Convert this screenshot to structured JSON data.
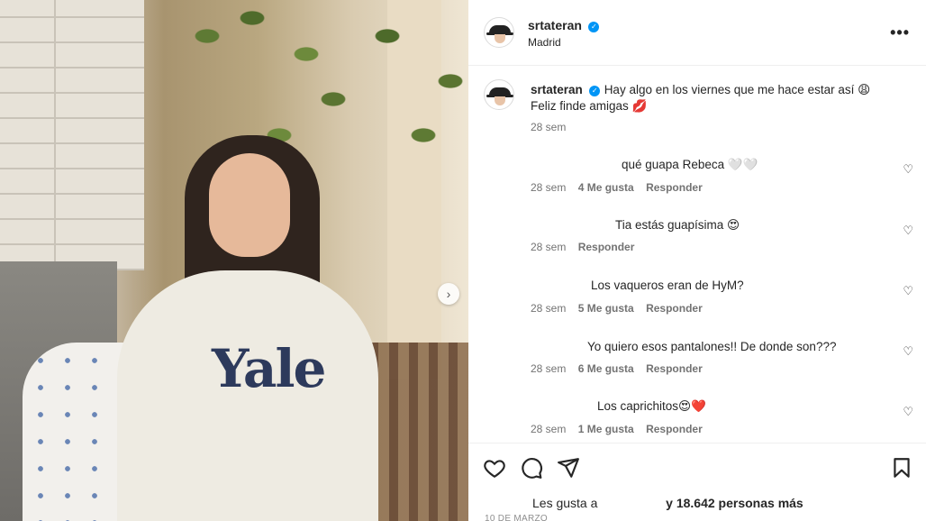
{
  "post": {
    "username": "srtateran",
    "location": "Madrid",
    "caption_line1": "Hay algo en los viernes que me hace estar así 😩",
    "caption_line2": "Feliz finde amigas 💋",
    "caption_time": "28 sem"
  },
  "comments": [
    {
      "text": "qué guapa Rebeca 🤍🤍",
      "time": "28 sem",
      "likes": "4 Me gusta",
      "reply": "Responder"
    },
    {
      "text": "Tia estás guapísima 😍",
      "time": "28 sem",
      "likes": "",
      "reply": "Responder"
    },
    {
      "text": "Los vaqueros eran de HyM?",
      "time": "28 sem",
      "likes": "5 Me gusta",
      "reply": "Responder"
    },
    {
      "text": "Yo quiero esos pantalones!! De donde son???",
      "time": "28 sem",
      "likes": "6 Me gusta",
      "reply": "Responder"
    },
    {
      "text": "Los caprichitos😍❤️",
      "time": "28 sem",
      "likes": "1 Me gusta",
      "reply": "Responder"
    }
  ],
  "likes_prefix": "Les gusta a",
  "likes_suffix": "y 18.642 personas más",
  "date": "10 DE MARZO",
  "photo_text": "Yale",
  "icons": {
    "like": "heart-icon",
    "comment": "comment-icon",
    "share": "send-icon",
    "save": "bookmark-icon",
    "more": "more-options-icon",
    "next": "chevron-right-icon"
  },
  "colors": {
    "verified": "#0095f6",
    "meta": "#737373"
  }
}
